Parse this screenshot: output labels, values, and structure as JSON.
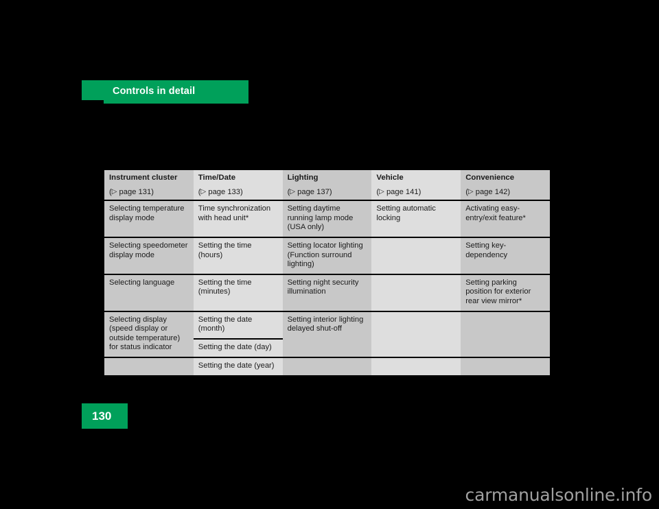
{
  "page": {
    "chapter_title": "Controls in detail",
    "page_number": "130",
    "watermark": "carmanualsonline.info"
  },
  "table": {
    "columns": [
      {
        "name": "Instrument cluster",
        "reference": "page 131",
        "ref_prefix": "(",
        "ref_suffix": ")",
        "ref_marker": "▷"
      },
      {
        "name": "Time/Date",
        "reference": "page 133",
        "ref_prefix": "(",
        "ref_suffix": ")",
        "ref_marker": "▷"
      },
      {
        "name": "Lighting",
        "reference": "page 137",
        "ref_prefix": "(",
        "ref_suffix": ")",
        "ref_marker": "▷"
      },
      {
        "name": "Vehicle",
        "reference": "page 141",
        "ref_prefix": "(",
        "ref_suffix": ")",
        "ref_marker": "▷"
      },
      {
        "name": "Convenience",
        "reference": "page 142",
        "ref_prefix": "(",
        "ref_suffix": ")",
        "ref_marker": "▷"
      }
    ],
    "rows": [
      {
        "instrument_cluster": "Selecting temperature display mode",
        "time_date": "Time synchronization with head unit*",
        "lighting": "Setting daytime running lamp mode (USA only)",
        "vehicle": "Setting automatic locking",
        "convenience": "Activating easy-entry/exit feature*"
      },
      {
        "instrument_cluster": "Selecting speedometer display mode",
        "time_date": "Setting the time (hours)",
        "lighting": "Setting locator lighting (Function surround lighting)",
        "vehicle": "",
        "convenience": "Setting key-dependency"
      },
      {
        "instrument_cluster": "Selecting language",
        "time_date": "Setting the time (minutes)",
        "lighting": "Setting night security illumination",
        "vehicle": "",
        "convenience": "Setting parking position for exterior rear view mirror*"
      },
      {
        "instrument_cluster": "Selecting display (speed display or outside temperature) for status indicator",
        "time_date": "Setting the date (month)",
        "lighting": "Setting interior lighting delayed shut-off",
        "vehicle": "",
        "convenience": ""
      },
      {
        "instrument_cluster": "",
        "time_date": "Setting the date (day)",
        "lighting": "",
        "vehicle": "",
        "convenience": ""
      },
      {
        "instrument_cluster": "",
        "time_date": "Setting the date (year)",
        "lighting": "",
        "vehicle": "",
        "convenience": ""
      }
    ]
  },
  "colors": {
    "brand_green": "#00a05a",
    "column_dark": "#c8c8c8",
    "column_light": "#dedede",
    "page_background": "#000000",
    "text": "#1a1a1a"
  }
}
